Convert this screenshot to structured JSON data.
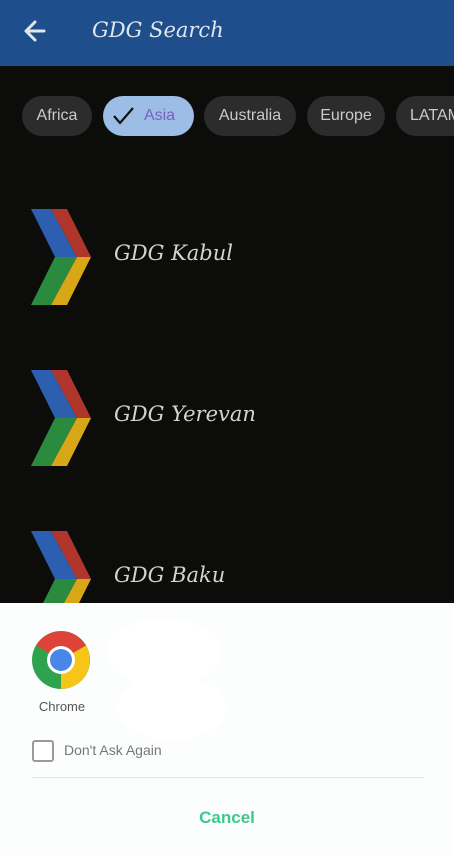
{
  "app_bar": {
    "title": "GDG Search",
    "back_icon": "arrow-back-icon",
    "color": "#1f4e8c"
  },
  "chips": [
    {
      "label": "Africa",
      "selected": false
    },
    {
      "label": "Asia",
      "selected": true
    },
    {
      "label": "Australia",
      "selected": false
    },
    {
      "label": "Europe",
      "selected": false
    },
    {
      "label": "LATAM",
      "selected": false
    }
  ],
  "list": [
    {
      "label": "GDG Kabul"
    },
    {
      "label": "GDG Yerevan"
    },
    {
      "label": "GDG Baku"
    }
  ],
  "chooser": {
    "app_label": "Chrome",
    "app_icon": "chrome-icon",
    "dont_ask_label": "Don't Ask Again",
    "dont_ask_checked": false,
    "cancel_label": "Cancel",
    "accent": "#3cc98b"
  }
}
